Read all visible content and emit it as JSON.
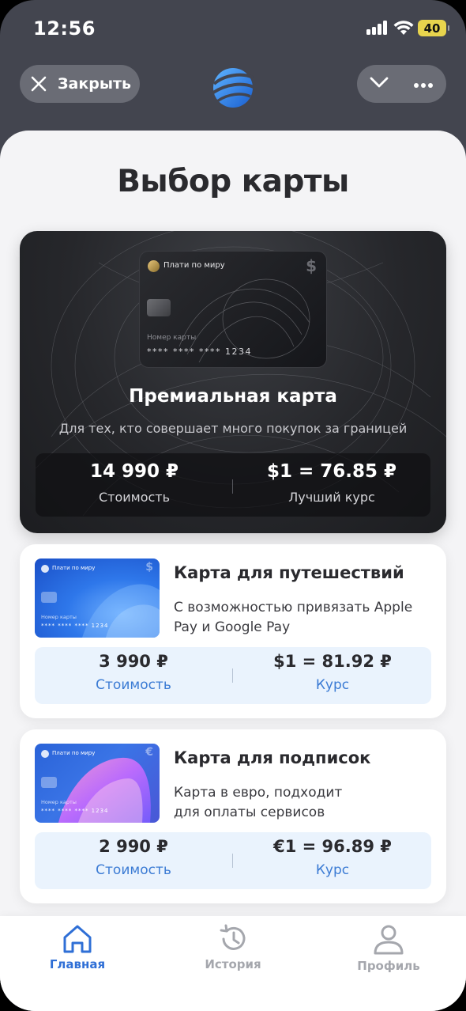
{
  "status_bar": {
    "time": "12:56",
    "battery": "40"
  },
  "top_nav": {
    "close_label": "Закрыть"
  },
  "page_title": "Выбор карты",
  "premium": {
    "card_brand": "Плати по миру",
    "card_currency": "$",
    "card_number_label": "Номер карты",
    "card_number": "**** **** **** 1234",
    "name": "Премиальная карта",
    "description": "Для тех, кто совершает много покупок за границей",
    "price_value": "14 990 ₽",
    "price_label": "Стоимость",
    "rate_value": "$1 = 76.85 ₽",
    "rate_label": "Лучший курс"
  },
  "offers": [
    {
      "card_brand": "Плати по миру",
      "card_currency": "$",
      "card_number_label": "Номер карты",
      "card_number": "**** **** **** 1234",
      "name": "Карта для путешествий",
      "description": "С возможностью привязать Apple Pay и Google Pay",
      "price_value": "3 990 ₽",
      "price_label": "Стоимость",
      "rate_value": "$1 = 81.92 ₽",
      "rate_label": "Курс"
    },
    {
      "card_brand": "Плати по миру",
      "card_currency": "€",
      "card_number_label": "Номер карты",
      "card_number": "**** **** **** 1234",
      "name": "Карта для подписок",
      "description": "Карта в евро, подходит для оплаты сервисов",
      "price_value": "2 990 ₽",
      "price_label": "Стоимость",
      "rate_value": "€1 = 96.89 ₽",
      "rate_label": "Курс"
    }
  ],
  "tabs": [
    {
      "label": "Главная",
      "icon": "home-icon",
      "active": true
    },
    {
      "label": "История",
      "icon": "history-icon",
      "active": false
    },
    {
      "label": "Профиль",
      "icon": "profile-icon",
      "active": false
    }
  ],
  "colors": {
    "accent": "#2f6fd6",
    "rate_label": "#3b7bd4",
    "tab_inactive": "#a5a7ad",
    "header_bg": "#43454f"
  }
}
